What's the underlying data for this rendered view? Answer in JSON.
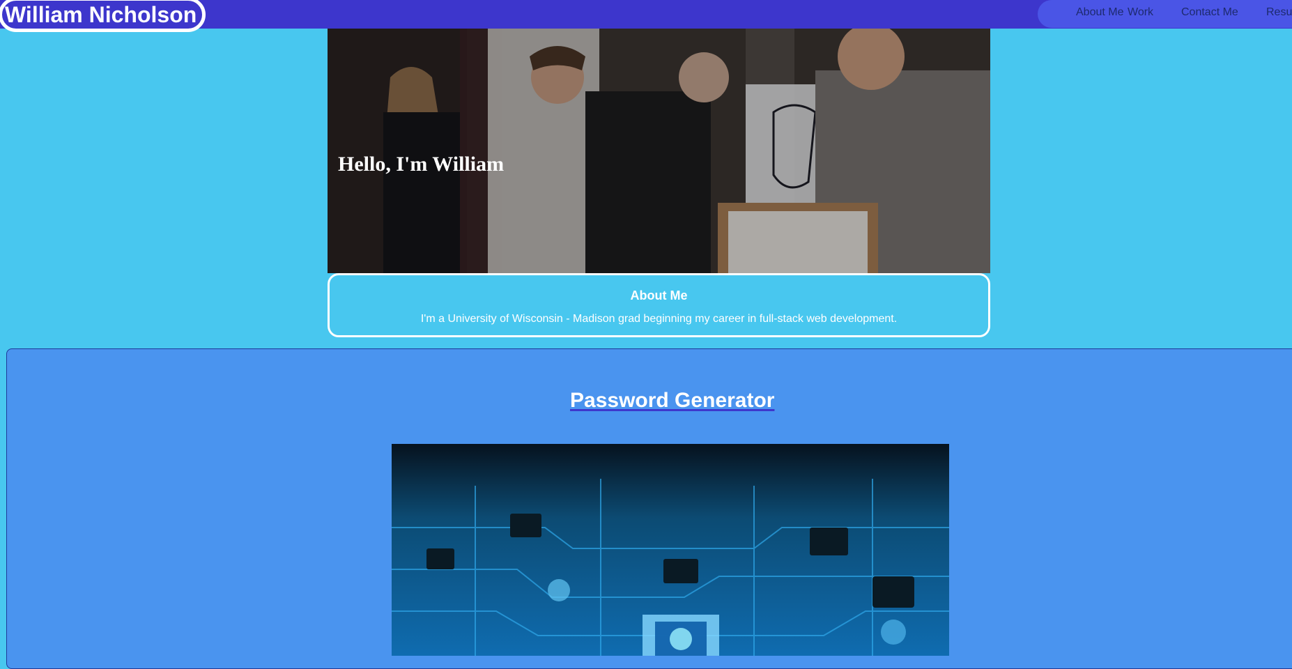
{
  "header": {
    "logo": "William Nicholson",
    "nav": [
      {
        "label": "About Me"
      },
      {
        "label": "Work"
      },
      {
        "label": "Contact Me"
      },
      {
        "label": "Resu"
      }
    ]
  },
  "hero": {
    "title": "Hello, I'm William"
  },
  "about": {
    "title": "About Me",
    "text": "I'm a University of Wisconsin - Madison grad beginning my career in full-stack web development."
  },
  "work": {
    "project_title": "Password Generator"
  },
  "colors": {
    "header_bg": "#3d36cc",
    "page_bg": "#48c7ef",
    "work_bg": "#4a94ef"
  }
}
